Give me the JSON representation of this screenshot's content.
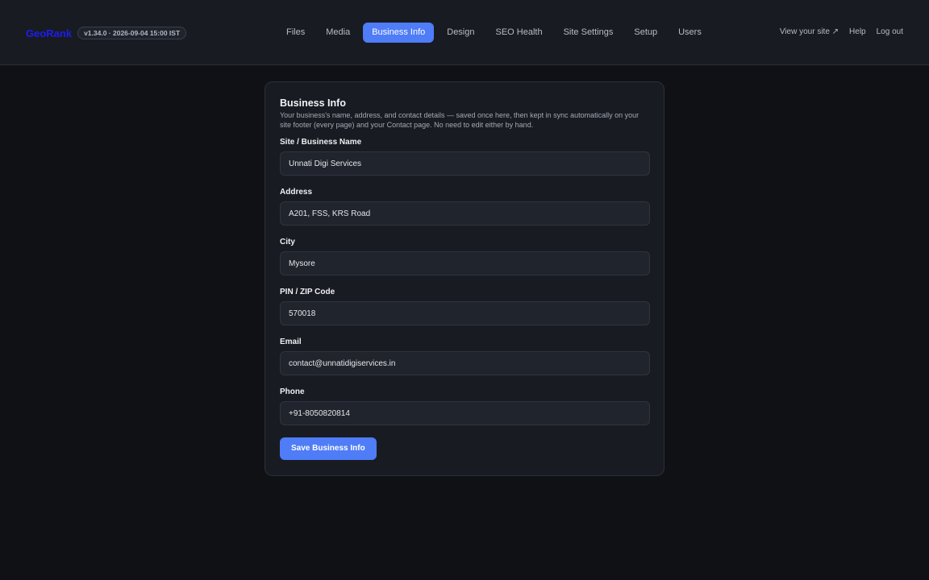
{
  "brand": {
    "name": "GeoRank",
    "version": "v1.34.0 · 2026-09-04 15:00 IST"
  },
  "nav": {
    "items": [
      {
        "label": "Files"
      },
      {
        "label": "Media"
      },
      {
        "label": "Business Info",
        "active": true
      },
      {
        "label": "Design"
      },
      {
        "label": "SEO Health"
      },
      {
        "label": "Site Settings"
      },
      {
        "label": "Setup"
      },
      {
        "label": "Users"
      }
    ]
  },
  "top_links": {
    "view_site": "View your site ↗",
    "help": "Help",
    "logout": "Log out"
  },
  "card": {
    "title": "Business Info",
    "description": "Your business's name, address, and contact details — saved once here, then kept in sync automatically on your site footer (every page) and your Contact page. No need to edit either by hand.",
    "fields": [
      {
        "label": "Site / Business Name",
        "value": "Unnati Digi Services"
      },
      {
        "label": "Address",
        "value": "A201, FSS, KRS Road"
      },
      {
        "label": "City",
        "value": "Mysore"
      },
      {
        "label": "PIN / ZIP Code",
        "value": "570018"
      },
      {
        "label": "Email",
        "value": "contact@unnatidigiservices.in"
      },
      {
        "label": "Phone",
        "value": "+91-8050820814"
      }
    ],
    "save_label": "Save Business Info"
  },
  "colors": {
    "accent": "#4f7cf7",
    "brand": "#1d1df0",
    "background": "#101114",
    "panel": "#181b22"
  }
}
